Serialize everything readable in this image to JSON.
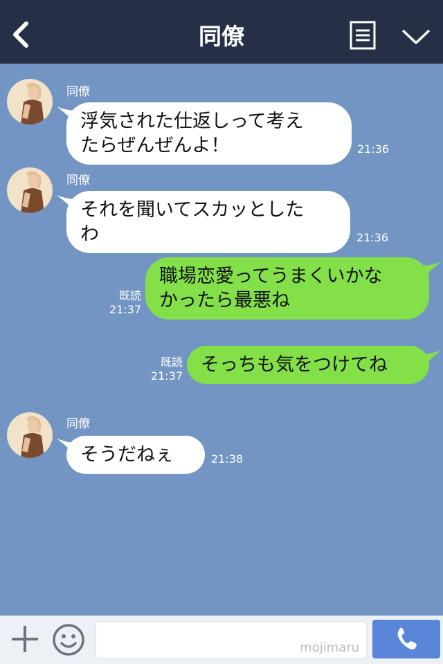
{
  "header": {
    "title": "同僚",
    "back_icon": "back-arrow-icon",
    "menu_icon": "menu-list-icon",
    "expand_icon": "chevron-down-icon",
    "background_color": "#253047"
  },
  "chat": {
    "background_color": "#7395c3",
    "messages": [
      {
        "side": "in",
        "sender": "同僚",
        "lines": [
          "浮気された仕返しって考え",
          "たらぜんぜんよ！"
        ],
        "time": "21:36"
      },
      {
        "side": "in",
        "sender": "同僚",
        "lines": [
          "それを聞いてスカッとした",
          "わ"
        ],
        "time": "21:36"
      },
      {
        "side": "out",
        "read": "既読",
        "lines": [
          "職場恋愛ってうまくいかな",
          "かったら最悪ね"
        ],
        "time": "21:37"
      },
      {
        "side": "out",
        "read": "既読",
        "lines": [
          "そっちも気をつけてね"
        ],
        "time": "21:37"
      },
      {
        "side": "in",
        "sender": "同僚",
        "lines": [
          "そうだねぇ"
        ],
        "time": "21:38"
      }
    ]
  },
  "footer": {
    "plus_icon": "plus-icon",
    "emoji_icon": "smiley-icon",
    "input_value": "mojimaru",
    "call_icon": "phone-icon",
    "call_button_color": "#5a86d9"
  }
}
